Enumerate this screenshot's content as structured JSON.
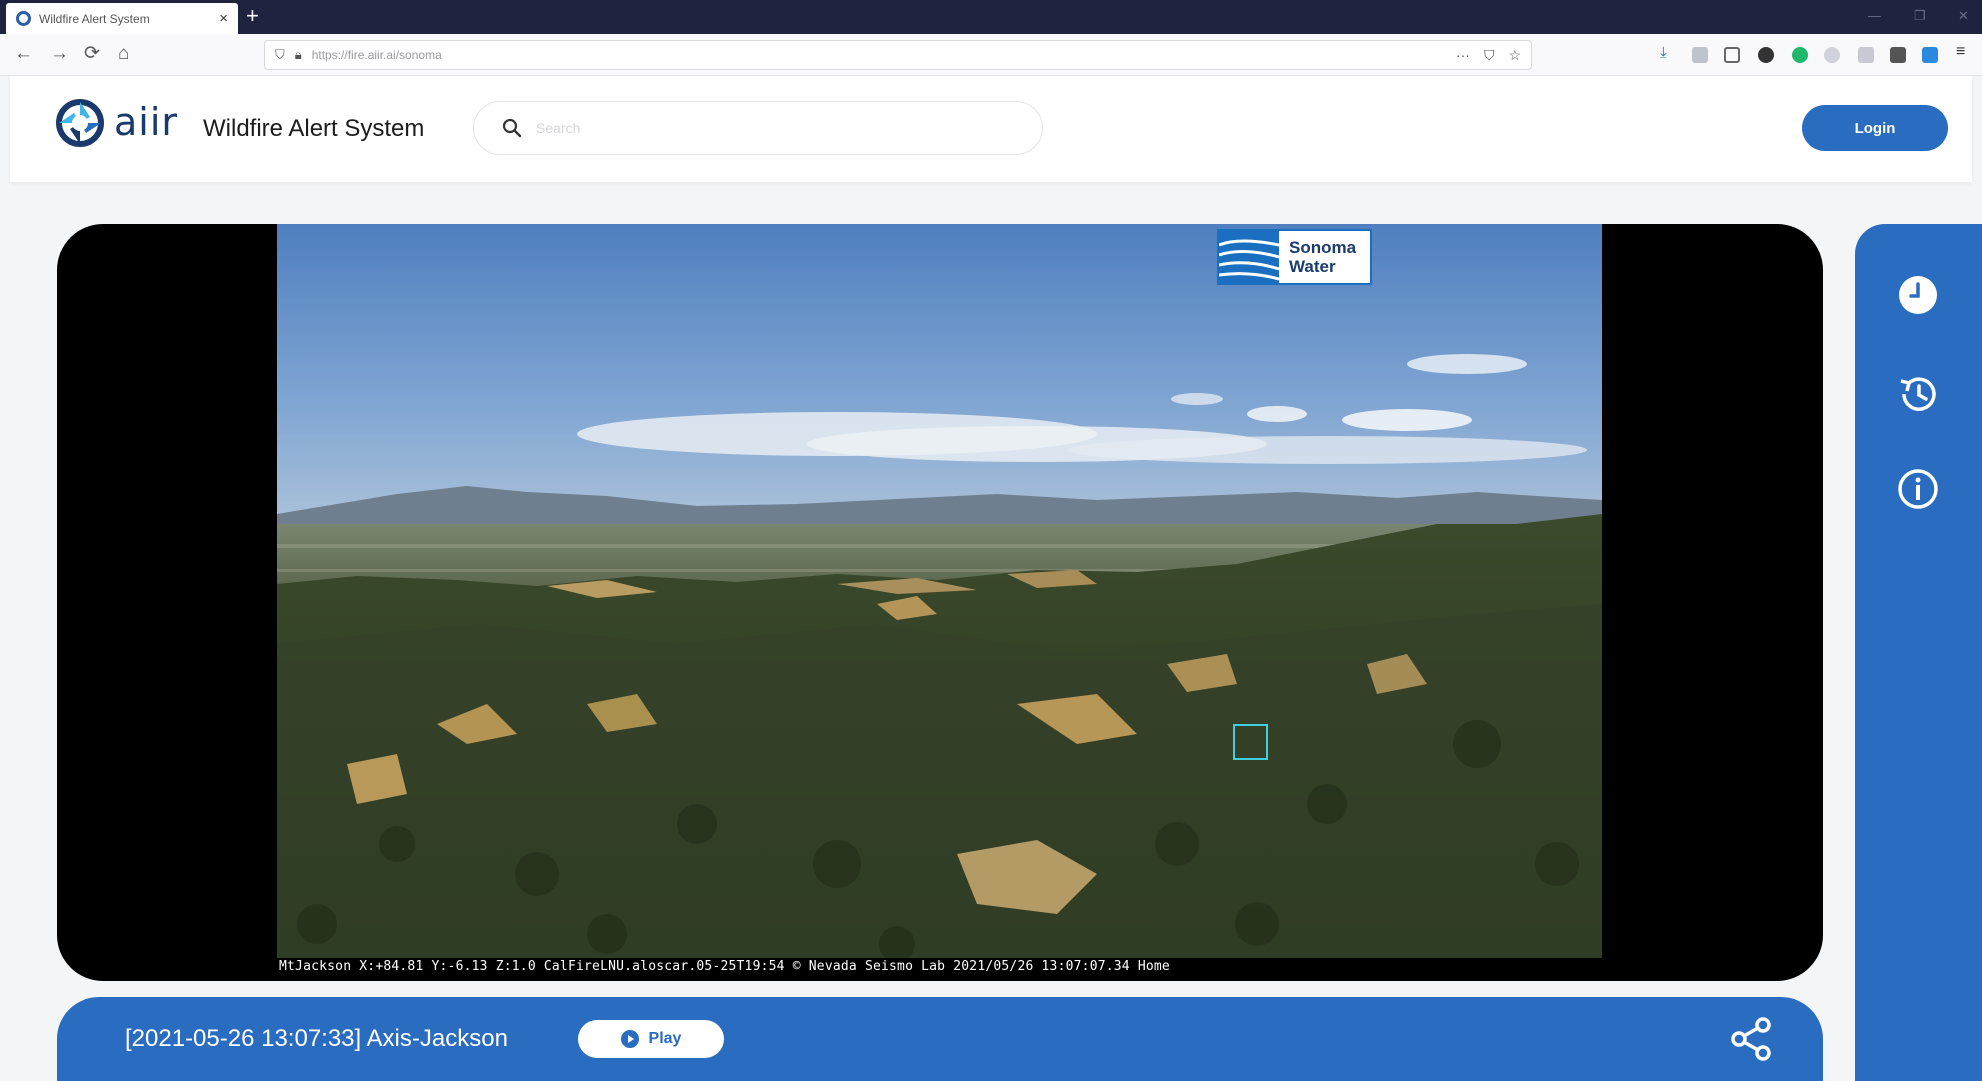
{
  "browser": {
    "tab_title": "Wildfire Alert System",
    "tab_close": "×",
    "new_tab": "+",
    "url": "https://fire.aiir.ai/sonoma",
    "url_more": "···",
    "nav_back": "←",
    "nav_forward": "→",
    "nav_reload": "⟳",
    "nav_home": "⌂"
  },
  "header": {
    "logo_text": "aiir",
    "app_title": "Wildfire Alert System",
    "search_placeholder": "Search",
    "login_label": "Login"
  },
  "camera": {
    "overlay_text": "MtJackson X:+84.81 Y:-6.13 Z:1.0 CalFireLNU.aloscar.05-25T19:54 © Nevada Seismo Lab 2021/05/26 13:07:07.34 Home",
    "partner_logo_line1": "Sonoma",
    "partner_logo_line2": "Water"
  },
  "bottom_bar": {
    "event_label": "[2021-05-26 13:07:33] Axis-Jackson",
    "play_label": "Play"
  },
  "side_panel": {
    "items": [
      "clock-icon",
      "history-icon",
      "info-icon"
    ]
  },
  "colors": {
    "accent": "#2a6cc0",
    "browser_tabbar": "#202340",
    "detection_box": "#3fd0e0"
  }
}
